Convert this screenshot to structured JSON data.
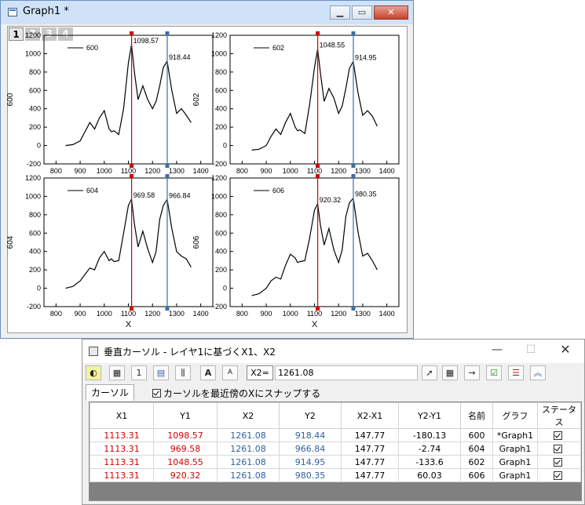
{
  "graph_window": {
    "title": "Graph1 *",
    "layer_tabs": [
      "1",
      "2",
      "3",
      "4"
    ],
    "active_tab": "1"
  },
  "panels": [
    {
      "legend": "600",
      "ylabel": "600",
      "cursor1_label": "1098.57",
      "cursor2_label": "918.44",
      "xlabel": ""
    },
    {
      "legend": "602",
      "ylabel": "602",
      "cursor1_label": "1048.55",
      "cursor2_label": "914.95",
      "xlabel": ""
    },
    {
      "legend": "604",
      "ylabel": "604",
      "cursor1_label": "969.58",
      "cursor2_label": "966.84",
      "xlabel": "X"
    },
    {
      "legend": "606",
      "ylabel": "606",
      "cursor1_label": "920.32",
      "cursor2_label": "980.35",
      "xlabel": "X"
    }
  ],
  "chart_data": {
    "type": "line",
    "xlim": [
      750,
      1450
    ],
    "ylim": [
      -200,
      1200
    ],
    "x_ticks": [
      "800",
      "900",
      "1000",
      "1100",
      "1200",
      "1300",
      "1400"
    ],
    "y_ticks": [
      "-200",
      "0",
      "200",
      "400",
      "600",
      "800",
      "1000",
      "1200"
    ],
    "cursor_x": [
      1113.31,
      1261.08
    ],
    "cursor_colors": [
      "#d40000",
      "#3a6fa8"
    ],
    "series": [
      {
        "name": "600",
        "x": [
          840,
          870,
          900,
          920,
          940,
          960,
          980,
          1000,
          1020,
          1030,
          1040,
          1060,
          1080,
          1100,
          1113,
          1125,
          1140,
          1160,
          1180,
          1200,
          1215,
          1230,
          1245,
          1261,
          1280,
          1300,
          1320,
          1340,
          1360
        ],
        "y": [
          0,
          10,
          50,
          150,
          250,
          180,
          300,
          380,
          180,
          150,
          160,
          120,
          400,
          900,
          1100,
          800,
          500,
          650,
          500,
          400,
          480,
          650,
          850,
          918,
          600,
          350,
          400,
          330,
          250
        ]
      },
      {
        "name": "602",
        "x": [
          840,
          870,
          900,
          920,
          940,
          960,
          980,
          1000,
          1020,
          1030,
          1040,
          1060,
          1080,
          1100,
          1113,
          1125,
          1140,
          1160,
          1180,
          1200,
          1215,
          1230,
          1245,
          1261,
          1280,
          1300,
          1320,
          1340,
          1360
        ],
        "y": [
          -50,
          -40,
          0,
          100,
          180,
          120,
          250,
          350,
          200,
          160,
          170,
          130,
          450,
          850,
          1050,
          780,
          480,
          620,
          520,
          350,
          430,
          620,
          840,
          915,
          580,
          330,
          380,
          320,
          210
        ]
      },
      {
        "name": "604",
        "x": [
          840,
          870,
          900,
          920,
          940,
          960,
          980,
          1000,
          1020,
          1030,
          1040,
          1060,
          1080,
          1100,
          1113,
          1125,
          1140,
          1160,
          1180,
          1200,
          1215,
          1230,
          1245,
          1261,
          1280,
          1300,
          1320,
          1340,
          1360
        ],
        "y": [
          0,
          20,
          80,
          150,
          220,
          200,
          330,
          400,
          300,
          320,
          290,
          300,
          600,
          900,
          970,
          700,
          450,
          620,
          430,
          280,
          400,
          750,
          900,
          967,
          650,
          400,
          350,
          320,
          230
        ]
      },
      {
        "name": "606",
        "x": [
          840,
          870,
          900,
          920,
          940,
          960,
          980,
          1000,
          1020,
          1030,
          1040,
          1060,
          1080,
          1100,
          1113,
          1125,
          1140,
          1160,
          1180,
          1200,
          1215,
          1230,
          1245,
          1261,
          1280,
          1300,
          1320,
          1340,
          1360
        ],
        "y": [
          -80,
          -60,
          0,
          80,
          120,
          100,
          250,
          370,
          330,
          280,
          290,
          300,
          550,
          850,
          920,
          680,
          470,
          650,
          420,
          280,
          420,
          780,
          930,
          980,
          620,
          350,
          380,
          300,
          200
        ]
      }
    ]
  },
  "cursor_dialog": {
    "title": "垂直カーソル - レイヤ1に基づくX1、X2",
    "x2_label": "X2=",
    "x2_value": "1261.08",
    "tab_label": "カーソル",
    "snap_label": "カーソルを最近傍のXにスナップする",
    "snap_checked": true,
    "columns": [
      "X1",
      "Y1",
      "X2",
      "Y2",
      "X2-X1",
      "Y2-Y1",
      "名前",
      "グラフ",
      "ステータス"
    ],
    "rows": [
      [
        "1113.31",
        "1098.57",
        "1261.08",
        "918.44",
        "147.77",
        "-180.13",
        "600",
        "*Graph1",
        true
      ],
      [
        "1113.31",
        "969.58",
        "1261.08",
        "966.84",
        "147.77",
        "-2.74",
        "604",
        "Graph1",
        true
      ],
      [
        "1113.31",
        "1048.55",
        "1261.08",
        "914.95",
        "147.77",
        "-133.6",
        "602",
        "Graph1",
        true
      ],
      [
        "1113.31",
        "920.32",
        "1261.08",
        "980.35",
        "147.77",
        "60.03",
        "606",
        "Graph1",
        true
      ]
    ]
  }
}
